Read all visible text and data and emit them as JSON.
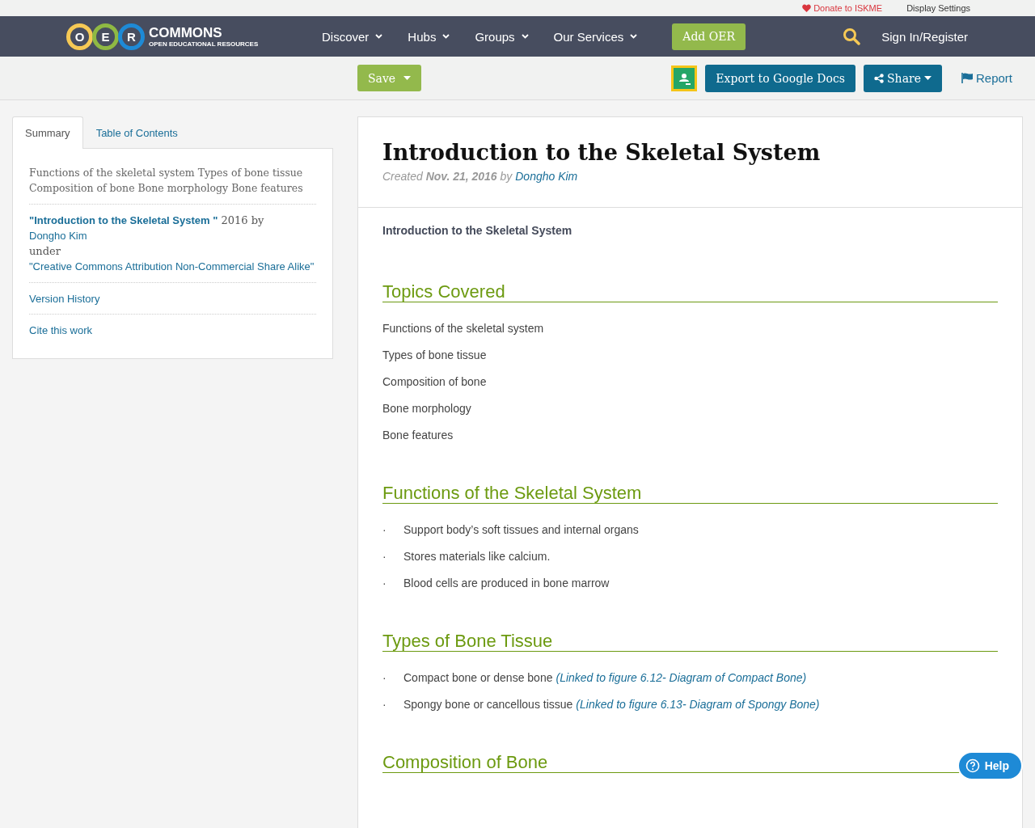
{
  "top_bar": {
    "donate": "Donate to ISKME",
    "display_settings": "Display Settings"
  },
  "nav": {
    "logo": {
      "letters": [
        "O",
        "E",
        "R"
      ],
      "name": "COMMONS",
      "tagline": "OPEN EDUCATIONAL RESOURCES"
    },
    "items": [
      {
        "label": "Discover"
      },
      {
        "label": "Hubs"
      },
      {
        "label": "Groups"
      },
      {
        "label": "Our Services"
      }
    ],
    "add_button": "Add OER",
    "sign_in": "Sign In/Register"
  },
  "actions": {
    "save": "Save",
    "export": "Export to Google Docs",
    "share": "Share",
    "report": "Report"
  },
  "sidebar": {
    "tabs": [
      {
        "label": "Summary",
        "selected": true
      },
      {
        "label": "Table of Contents",
        "selected": false
      }
    ],
    "summary": "Functions of the skeletal system Types of bone tissue Composition of bone Bone morphology Bone features",
    "attribution": {
      "title": "\"Introduction to the Skeletal System \"",
      "year_by": "2016 by",
      "author": "Dongho Kim",
      "under": "under",
      "license": "\"Creative Commons Attribution Non-Commercial Share Alike\""
    },
    "links": [
      "Version History",
      "Cite this work"
    ]
  },
  "article": {
    "title": "Introduction to the Skeletal System",
    "created": {
      "prefix": "Created",
      "date": "Nov. 21, 2016",
      "by": "by",
      "author": "Dongho Kim"
    },
    "intro": "Introduction to the Skeletal System",
    "sections": [
      {
        "heading": "Topics Covered",
        "items": [
          {
            "kind": "plain",
            "text": "Functions of the skeletal system"
          },
          {
            "kind": "plain",
            "text": "Types of bone tissue"
          },
          {
            "kind": "plain",
            "text": "Composition of bone"
          },
          {
            "kind": "plain",
            "text": "Bone morphology"
          },
          {
            "kind": "plain",
            "text": "Bone features"
          }
        ]
      },
      {
        "heading": "Functions of the Skeletal System",
        "items": [
          {
            "kind": "bullet",
            "bullet": "·",
            "text": "Support body’s soft tissues and internal organs"
          },
          {
            "kind": "bullet",
            "bullet": "·",
            "text": "Stores materials like calcium."
          },
          {
            "kind": "bullet",
            "bullet": "·",
            "text": "Blood cells are produced in bone marrow"
          }
        ]
      },
      {
        "heading": "Types of Bone Tissue",
        "items": [
          {
            "kind": "bullet",
            "bullet": "·",
            "text": "Compact bone or dense bone",
            "link": "(Linked to figure 6.12- Diagram of Compact Bone)"
          },
          {
            "kind": "bullet",
            "bullet": "·",
            "text": "Spongy bone or cancellous tissue",
            "link": "(Linked to figure 6.13- Diagram of Spongy Bone)"
          }
        ]
      },
      {
        "heading": "Composition of Bone"
      }
    ]
  },
  "help": "Help"
}
